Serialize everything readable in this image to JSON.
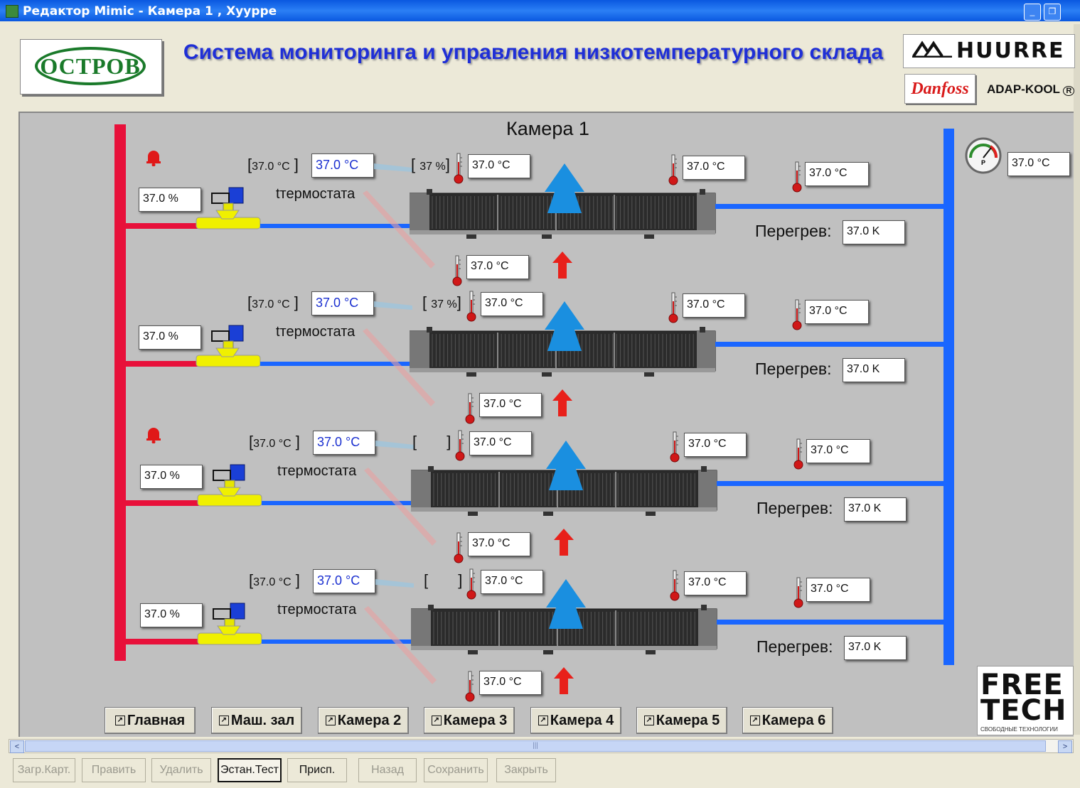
{
  "window": {
    "title": "Редактор Mimic - Камера 1 , Хуурре"
  },
  "header": {
    "logo_text": "ОСТРОВ",
    "title": "Система мониторинга и управления низкотемпературного склада",
    "huurre": "HUURRE",
    "danfoss": "Danfoss",
    "adapkool": "ADAP-KOOL"
  },
  "camera_title": "Камера 1",
  "suction_temp": "37.0 °C",
  "evaporators": [
    {
      "setpoint": "37.0 °C",
      "thermostat": "37.0 °C",
      "thermostat_label": "tтермостата",
      "valve_pct": "37.0 %",
      "opening": "37 %",
      "t_in": "37.0 °C",
      "t_out": "37.0 °C",
      "t_line": "37.0 °C",
      "t_air": "37.0 °C",
      "superheat_label": "Перегрев:",
      "superheat": "37.0 K",
      "alarm": true
    },
    {
      "setpoint": "37.0 °C",
      "thermostat": "37.0 °C",
      "thermostat_label": "tтермостата",
      "valve_pct": "37.0 %",
      "opening": "37 %",
      "t_in": "37.0 °C",
      "t_out": "37.0 °C",
      "t_line": "37.0 °C",
      "t_air": "37.0 °C",
      "superheat_label": "Перегрев:",
      "superheat": "37.0 K",
      "alarm": false
    },
    {
      "setpoint": "37.0 °C",
      "thermostat": "37.0 °C",
      "thermostat_label": "tтермостата",
      "valve_pct": "37.0 %",
      "opening": "",
      "t_in": "37.0 °C",
      "t_out": "37.0 °C",
      "t_line": "37.0 °C",
      "t_air": "37.0 °C",
      "superheat_label": "Перегрев:",
      "superheat": "37.0 K",
      "alarm": true
    },
    {
      "setpoint": "37.0 °C",
      "thermostat": "37.0 °C",
      "thermostat_label": "tтермостата",
      "valve_pct": "37.0 %",
      "opening": "",
      "t_in": "37.0 °C",
      "t_out": "37.0 °C",
      "t_line": "37.0 °C",
      "t_air": "37.0 °C",
      "superheat_label": "Перегрев:",
      "superheat": "37.0 K",
      "alarm": false
    }
  ],
  "nav": [
    "Главная",
    "Маш. зал",
    "Камера 2",
    "Камера 3",
    "Камера 4",
    "Камера 5",
    "Камера 6"
  ],
  "freetech": {
    "line1": "FREE",
    "line2": "TECH",
    "sub": "СВОБОДНЫЕ  ТЕХНОЛОГИИ"
  },
  "toolbar": [
    "Загр.Карт.",
    "Править",
    "Удалить",
    "Эстан.Тест",
    "Присп.",
    "Назад",
    "Сохранить",
    "Закрыть"
  ],
  "colors": {
    "supply": "#e8103a",
    "suction": "#1a66ff",
    "title": "#1f2fd6",
    "fan_arrow": "#1a8fe0",
    "air_in": "#e8201a"
  }
}
